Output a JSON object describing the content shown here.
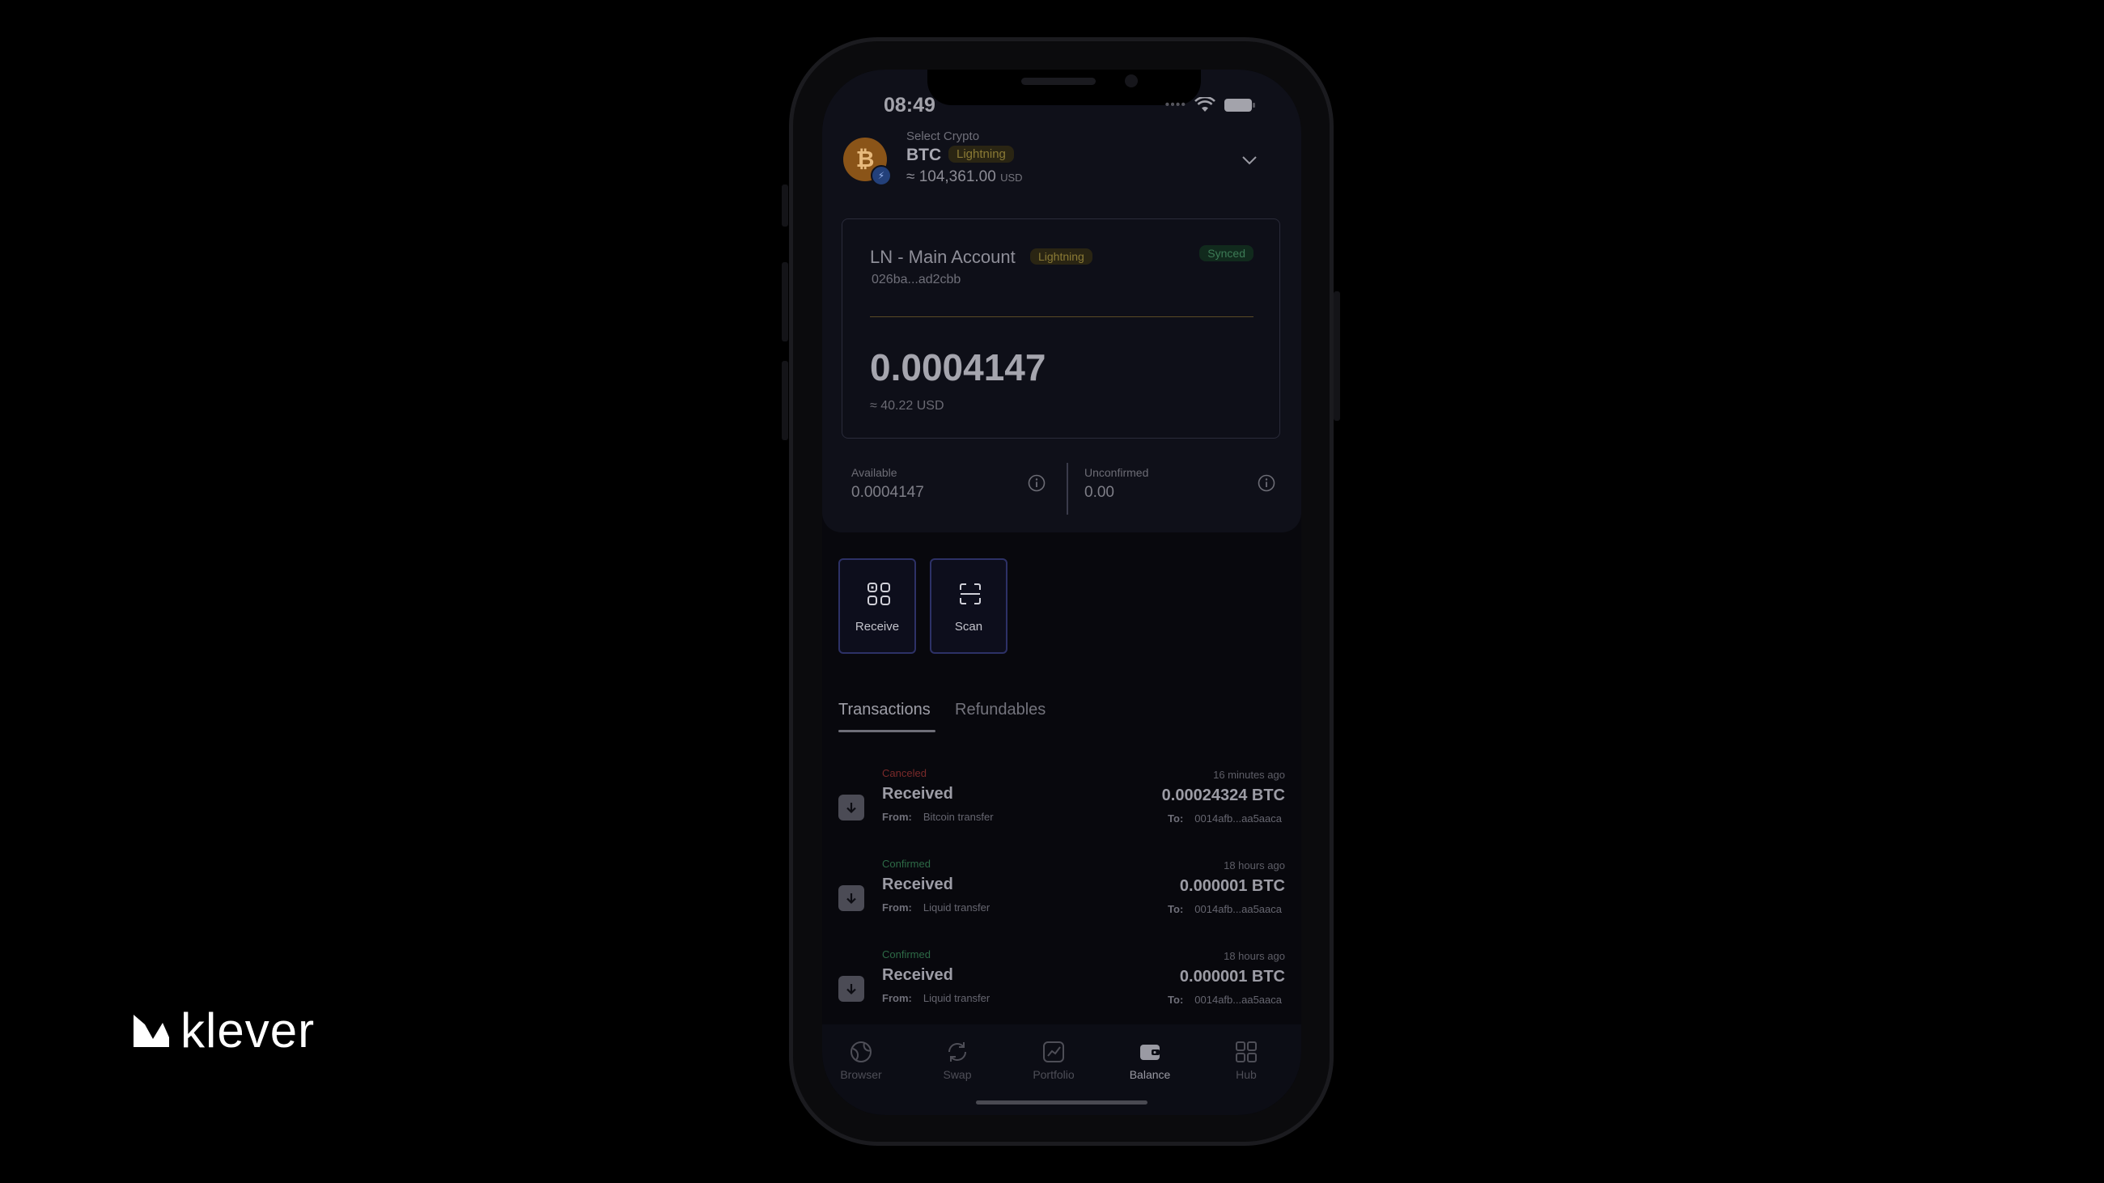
{
  "brand": {
    "name": "klever"
  },
  "status_bar": {
    "time": "08:49"
  },
  "crypto_select": {
    "label": "Select Crypto",
    "ticker": "BTC",
    "network_chip": "Lightning",
    "price": "≈ 104,361.00",
    "price_unit": "USD",
    "logo_glyph": "₿"
  },
  "account": {
    "name": "LN - Main Account",
    "network_chip": "Lightning",
    "sync_status": "Synced",
    "address": "026ba...ad2cbb",
    "balance": "0.0004147",
    "balance_usd": "≈ 40.22 USD"
  },
  "stats": {
    "available_label": "Available",
    "available_value": "0.0004147",
    "unconfirmed_label": "Unconfirmed",
    "unconfirmed_value": "0.00"
  },
  "actions": {
    "receive": "Receive",
    "scan": "Scan"
  },
  "tabs": {
    "transactions": "Transactions",
    "refundables": "Refundables"
  },
  "transactions": [
    {
      "status": "Canceled",
      "title": "Received",
      "from_label": "From:",
      "from": "Bitcoin transfer",
      "time": "16 minutes ago",
      "amount": "0.00024324 BTC",
      "to_label": "To:",
      "to": "0014afb...aa5aaca"
    },
    {
      "status": "Confirmed",
      "title": "Received",
      "from_label": "From:",
      "from": "Liquid transfer",
      "time": "18 hours ago",
      "amount": "0.000001 BTC",
      "to_label": "To:",
      "to": "0014afb...aa5aaca"
    },
    {
      "status": "Confirmed",
      "title": "Received",
      "from_label": "From:",
      "from": "Liquid transfer",
      "time": "18 hours ago",
      "amount": "0.000001 BTC",
      "to_label": "To:",
      "to": "0014afb...aa5aaca"
    }
  ],
  "nav": {
    "browser": "Browser",
    "swap": "Swap",
    "portfolio": "Portfolio",
    "balance": "Balance",
    "hub": "Hub",
    "active": "Balance"
  },
  "colors": {
    "background": "#000000",
    "accent_lightning": "#8a7a35",
    "synced": "#3c7a55",
    "canceled": "#7a2a2a",
    "confirmed": "#2d6a46"
  }
}
